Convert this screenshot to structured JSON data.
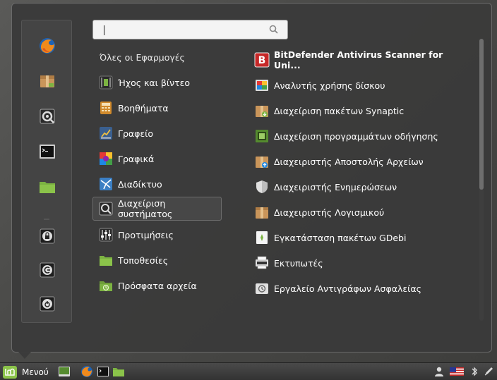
{
  "search": {
    "placeholder": "",
    "value": ""
  },
  "favorites": [
    {
      "name": "firefox"
    },
    {
      "name": "software-manager"
    },
    {
      "name": "system-settings"
    },
    {
      "name": "terminal"
    },
    {
      "name": "files"
    },
    {
      "name": "lock-screen"
    },
    {
      "name": "logout"
    },
    {
      "name": "quit"
    }
  ],
  "categories": {
    "header": "Όλες οι Εφαρμογές",
    "items": [
      {
        "label": "Ήχος και βίντεο",
        "icon": "multimedia-icon"
      },
      {
        "label": "Βοηθήματα",
        "icon": "accessories-icon"
      },
      {
        "label": "Γραφείο",
        "icon": "office-icon"
      },
      {
        "label": "Γραφικά",
        "icon": "graphics-icon"
      },
      {
        "label": "Διαδίκτυο",
        "icon": "internet-icon"
      },
      {
        "label": "Διαχείριση συστήματος",
        "icon": "administration-icon",
        "selected": true
      },
      {
        "label": "Προτιμήσεις",
        "icon": "preferences-icon"
      },
      {
        "label": "Τοποθεσίες",
        "icon": "places-icon"
      },
      {
        "label": "Πρόσφατα αρχεία",
        "icon": "recent-files-icon"
      }
    ]
  },
  "apps": [
    {
      "label": "BitDefender Antivirus Scanner for Uni...",
      "icon": "bitdefender-icon",
      "bold": true
    },
    {
      "label": "Αναλυτής χρήσης δίσκου",
      "icon": "disk-usage-icon"
    },
    {
      "label": "Διαχείριση πακέτων Synaptic",
      "icon": "synaptic-icon"
    },
    {
      "label": "Διαχείριση προγραμμάτων οδήγησης",
      "icon": "driver-manager-icon"
    },
    {
      "label": "Διαχειριστής Αποστολής Αρχείων",
      "icon": "upload-manager-icon"
    },
    {
      "label": "Διαχειριστής Ενημερώσεων",
      "icon": "update-manager-icon"
    },
    {
      "label": "Διαχειριστής Λογισμικού",
      "icon": "software-manager-icon"
    },
    {
      "label": "Εγκατάσταση πακέτων GDebi",
      "icon": "gdebi-icon"
    },
    {
      "label": "Εκτυπωτές",
      "icon": "printer-icon"
    },
    {
      "label": "Εργαλείο Αντιγράφων Ασφαλείας",
      "icon": "backup-tool-icon"
    }
  ],
  "panel": {
    "menu_label": "Μενού",
    "launchers": [
      "show-desktop",
      "firefox",
      "terminal",
      "files"
    ],
    "tray": [
      "user-icon",
      "us-flag-icon",
      "bluetooth-icon",
      "pen-icon"
    ]
  },
  "colors": {
    "accent_green": "#7cb342",
    "menu_bg": "#3a3a3a",
    "text": "#ffffff"
  }
}
